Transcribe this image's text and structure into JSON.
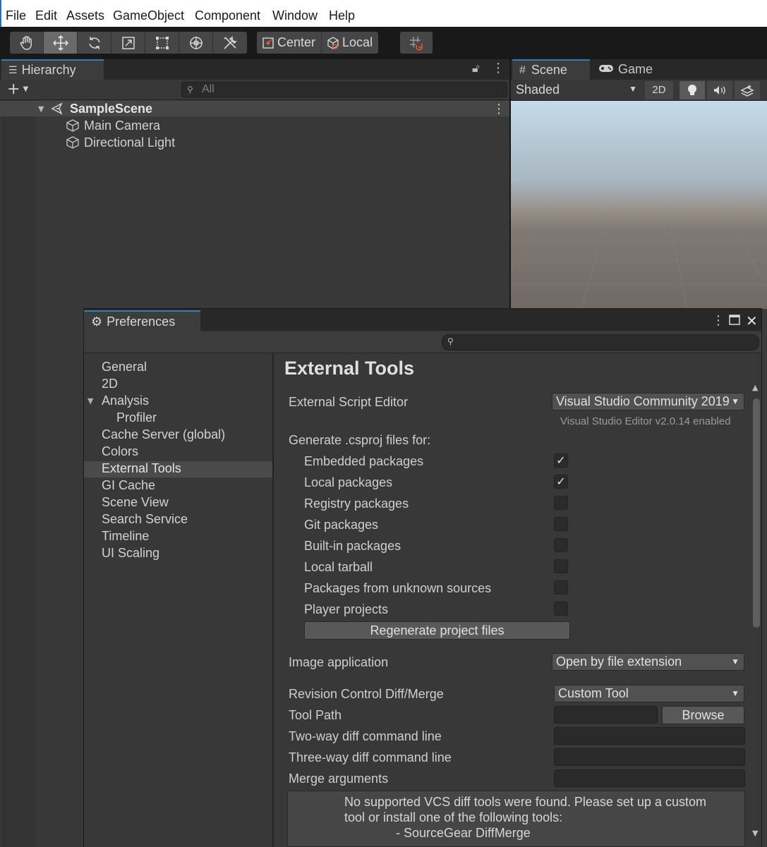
{
  "menu": [
    "File",
    "Edit",
    "Assets",
    "GameObject",
    "Component",
    "Window",
    "Help"
  ],
  "toolbar": {
    "tools": [
      "hand-tool",
      "move-tool",
      "rotate-tool",
      "scale-tool",
      "rect-tool",
      "transform-tool",
      "custom-tool"
    ],
    "pivot_label": "Center",
    "space_label": "Local"
  },
  "hierarchy": {
    "tab_label": "Hierarchy",
    "search_placeholder": "All",
    "scene_name": "SampleScene",
    "objects": [
      "Main Camera",
      "Directional Light"
    ]
  },
  "scene": {
    "tab_scene": "Scene",
    "tab_game": "Game",
    "shading_mode": "Shaded",
    "mode_2d": "2D"
  },
  "preferences": {
    "title": "Preferences",
    "nav": {
      "general": "General",
      "2d": "2D",
      "analysis": "Analysis",
      "profiler": "Profiler",
      "cache_server": "Cache Server (global)",
      "colors": "Colors",
      "external_tools": "External Tools",
      "gi_cache": "GI Cache",
      "scene_view": "Scene View",
      "search_service": "Search Service",
      "timeline": "Timeline",
      "ui_scaling": "UI Scaling"
    },
    "heading": "External Tools",
    "script_editor_label": "External Script Editor",
    "script_editor_value": "Visual Studio Community 2019",
    "script_editor_note": "Visual Studio Editor v2.0.14 enabled",
    "csproj_label": "Generate .csproj files for:",
    "csproj_options": [
      {
        "label": "Embedded packages",
        "checked": true
      },
      {
        "label": "Local packages",
        "checked": true
      },
      {
        "label": "Registry packages",
        "checked": false
      },
      {
        "label": "Git packages",
        "checked": false
      },
      {
        "label": "Built-in packages",
        "checked": false
      },
      {
        "label": "Local tarball",
        "checked": false
      },
      {
        "label": "Packages from unknown sources",
        "checked": false
      },
      {
        "label": "Player projects",
        "checked": false
      }
    ],
    "regenerate_label": "Regenerate project files",
    "image_app_label": "Image application",
    "image_app_value": "Open by file extension",
    "diff_label": "Revision Control Diff/Merge",
    "diff_value": "Custom Tool",
    "tool_path_label": "Tool Path",
    "tool_path_value": "",
    "browse_label": "Browse",
    "two_way_label": "Two-way diff command line",
    "two_way_value": "",
    "three_way_label": "Three-way diff command line",
    "three_way_value": "",
    "merge_label": "Merge arguments",
    "merge_value": "",
    "help_line1": "No supported VCS diff tools were found. Please set up a custom",
    "help_line2": "tool or install one of the following tools:",
    "help_line3": "- SourceGear DiffMerge"
  },
  "colors": {
    "accent": "#3a79bb",
    "panel_bg": "#383838",
    "menubar_bg": "#ffffff"
  }
}
